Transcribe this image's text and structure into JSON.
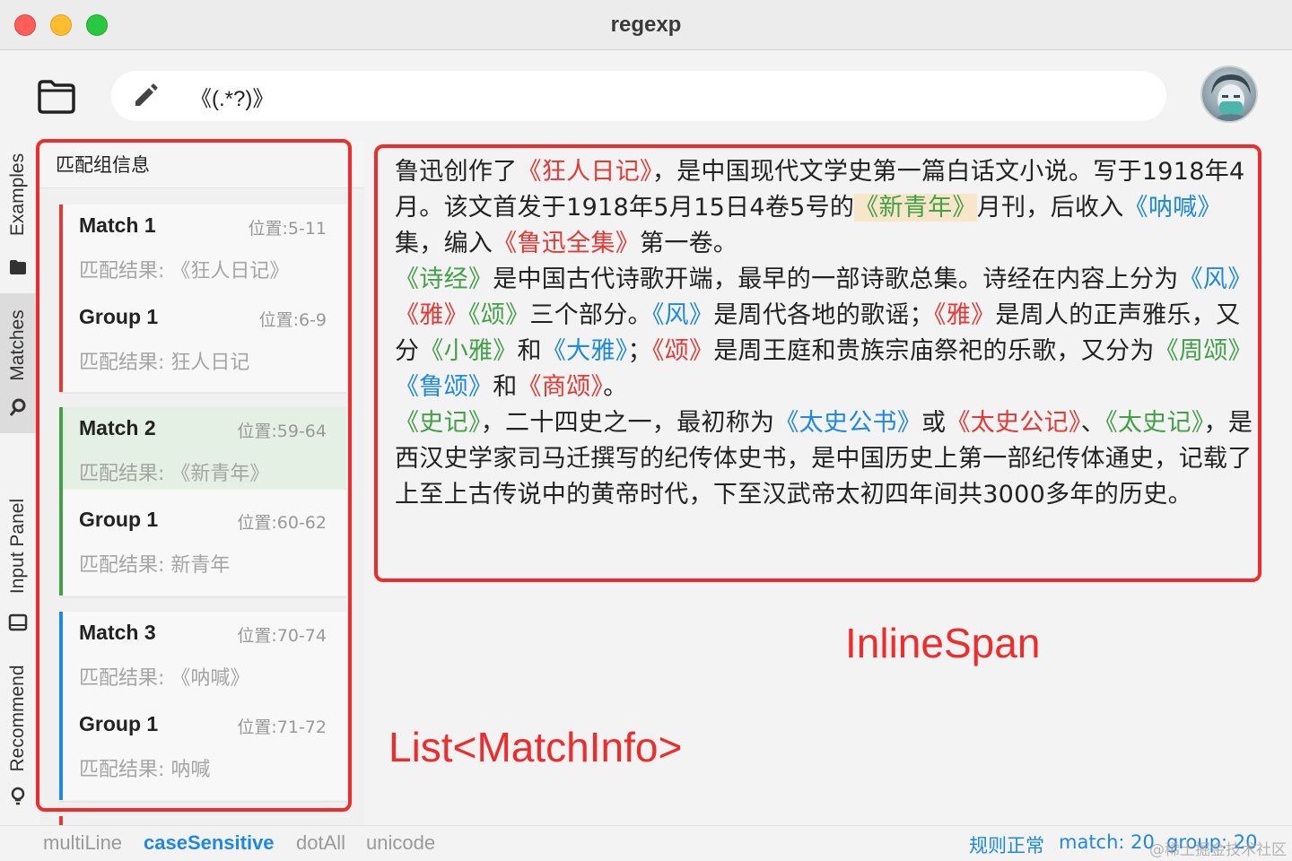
{
  "window": {
    "title": "regexp"
  },
  "toolbar": {
    "pattern_value": "《(.*?)》"
  },
  "side_tabs": {
    "examples": "Examples",
    "matches": "Matches",
    "input_panel": "Input Panel",
    "recommend": "Recommend"
  },
  "left_panel": {
    "header": "匹配组信息",
    "matches": [
      {
        "title": "Match  1",
        "position": "位置:5-11",
        "result": "匹配结果: 《狂人日记》",
        "group": {
          "title": "Group  1",
          "position": "位置:6-9",
          "result": "匹配结果: 狂人日记"
        },
        "accent": "#e53935"
      },
      {
        "title": "Match  2",
        "position": "位置:59-64",
        "result": "匹配结果: 《新青年》",
        "group": {
          "title": "Group  1",
          "position": "位置:60-62",
          "result": "匹配结果: 新青年"
        },
        "accent": "#43a047"
      },
      {
        "title": "Match  3",
        "position": "位置:70-74",
        "result": "匹配结果: 《呐喊》",
        "group": {
          "title": "Group  1",
          "position": "位置:71-72",
          "result": "匹配结果: 呐喊"
        },
        "accent": "#1e88e5"
      }
    ]
  },
  "text": {
    "p1": [
      "鲁迅创作了",
      "《狂人日记》",
      "，是中国现代文学史第一篇白话文小说。写于1918年4月。该文首发于1918年5月15日4卷5号的",
      "《新青年》",
      "月刊，后收入",
      "《呐喊》",
      "集，编入",
      "《鲁迅全集》",
      "第一卷。"
    ],
    "p2": [
      "《诗经》",
      "是中国古代诗歌开端，最早的一部诗歌总集。诗经在内容上分为",
      "《风》",
      "《雅》",
      "《颂》",
      "三个部分。",
      "《风》",
      "是周代各地的歌谣；",
      "《雅》",
      "是周人的正声雅乐，又分",
      "《小雅》",
      "和",
      "《大雅》",
      "；",
      "《颂》",
      "是周王庭和贵族宗庙祭祀的乐歌，又分为",
      "《周颂》",
      "《鲁颂》",
      "和",
      "《商颂》",
      "。"
    ],
    "p3": [
      "《史记》",
      "，二十四史之一，最初称为",
      "《太史公书》",
      "或",
      "《太史公记》",
      "、",
      "《太史记》",
      "，是西汉史学家司马迁撰写的纪传体史书，是中国历史上第一部纪传体通史，记载了上至上古传说中的黄帝时代，下至汉武帝太初四年间共3000多年的历史。"
    ]
  },
  "annotations": {
    "left_label": "List<MatchInfo>",
    "right_label": "InlineSpan"
  },
  "status": {
    "flags": [
      "multiLine",
      "caseSensitive",
      "dotAll",
      "unicode"
    ],
    "active_flag": "caseSensitive",
    "rule_status": "规则正常",
    "match_count": "match: 20",
    "group_count": "group: 20"
  },
  "watermark": "@稀土掘金技术社区",
  "colors": {
    "red": "#e53935",
    "green": "#43a047",
    "blue": "#1e88e5",
    "accent": "#1e88e5",
    "annotation": "#ef2b2b"
  },
  "icons": [
    "folder-icon",
    "pencil-icon",
    "user-avatar",
    "folder-tab-icon",
    "search-tab-icon",
    "input-panel-icon",
    "lightbulb-icon"
  ]
}
